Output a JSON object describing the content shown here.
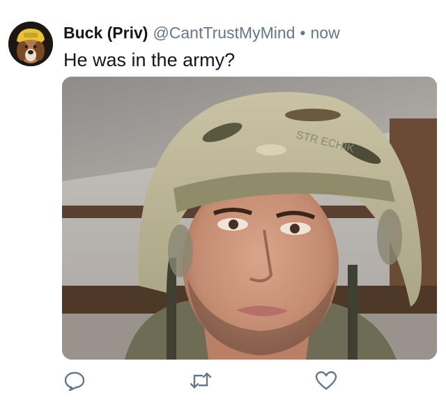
{
  "tweet": {
    "author_name": "Buck (Priv)",
    "author_handle": "@CantTrustMyMind",
    "separator": "•",
    "timestamp": "now",
    "text": "He was in the army?"
  },
  "media": {
    "helmet_text": "STR ECHIK"
  },
  "actions": [
    {
      "name": "reply",
      "icon": "speech-bubble-icon"
    },
    {
      "name": "retweet",
      "icon": "retweet-icon"
    },
    {
      "name": "like",
      "icon": "heart-icon"
    }
  ],
  "colors": {
    "text_primary": "#14171a",
    "text_secondary": "#657786",
    "icon": "#657786",
    "avatar_hat": "#e6c33a"
  }
}
